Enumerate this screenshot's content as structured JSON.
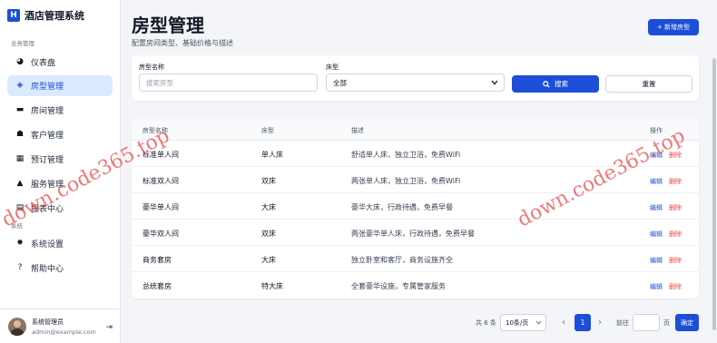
{
  "brand": {
    "logo_char": "H",
    "name": "酒店管理系统"
  },
  "sidebar": {
    "section_business": "业务管理",
    "section_system": "系统",
    "items": [
      {
        "label": "仪表盘",
        "icon": "pie-chart-icon",
        "glyph": "◕"
      },
      {
        "label": "房型管理",
        "icon": "layers-icon",
        "glyph": "◈"
      },
      {
        "label": "房间管理",
        "icon": "bed-icon",
        "glyph": "▬"
      },
      {
        "label": "客户管理",
        "icon": "users-icon",
        "glyph": "☗"
      },
      {
        "label": "预订管理",
        "icon": "calendar-icon",
        "glyph": "▦"
      },
      {
        "label": "服务管理",
        "icon": "bell-icon",
        "glyph": "▲"
      },
      {
        "label": "报表中心",
        "icon": "chart-icon",
        "glyph": "▤"
      },
      {
        "label": "系统设置",
        "icon": "gear-icon",
        "glyph": "✹"
      },
      {
        "label": "帮助中心",
        "icon": "help-icon",
        "glyph": "?"
      }
    ],
    "active_index": 1
  },
  "user": {
    "name": "系统管理员",
    "email": "admin@example.com",
    "logout_glyph": "⇥"
  },
  "header": {
    "title": "房型管理",
    "subtitle": "配置房间类型、基础价格与描述",
    "add_button": "+ 新增房型"
  },
  "filter": {
    "name_label": "房型名称",
    "name_placeholder": "搜索房型",
    "bed_label": "床型",
    "bed_value": "全部",
    "search_button": "搜索",
    "reset_button": "重置"
  },
  "table": {
    "columns": [
      "房型名称",
      "床型",
      "描述",
      "操作"
    ],
    "edit_label": "编辑",
    "delete_label": "删除",
    "rows": [
      {
        "name": "标准单人间",
        "bed": "单人床",
        "desc": "舒适单人床，独立卫浴，免费WiFi"
      },
      {
        "name": "标准双人间",
        "bed": "双床",
        "desc": "两张单人床，独立卫浴，免费WiFi"
      },
      {
        "name": "豪华单人间",
        "bed": "大床",
        "desc": "豪华大床，行政待遇，免费早餐"
      },
      {
        "name": "豪华双人间",
        "bed": "双床",
        "desc": "两张豪华单人床，行政待遇，免费早餐"
      },
      {
        "name": "商务套房",
        "bed": "大床",
        "desc": "独立卧室和客厅，商务设施齐全"
      },
      {
        "name": "总统套房",
        "bed": "特大床",
        "desc": "全套豪华设施，专属管家服务"
      }
    ]
  },
  "pagination": {
    "total": "共 6 条",
    "page_size": "10条/页",
    "prev_glyph": "‹",
    "current_page": "1",
    "next_glyph": "›",
    "goto_label": "前往",
    "page_unit": "页",
    "confirm": "确定"
  },
  "watermark": {
    "text": "down.code365.top"
  }
}
